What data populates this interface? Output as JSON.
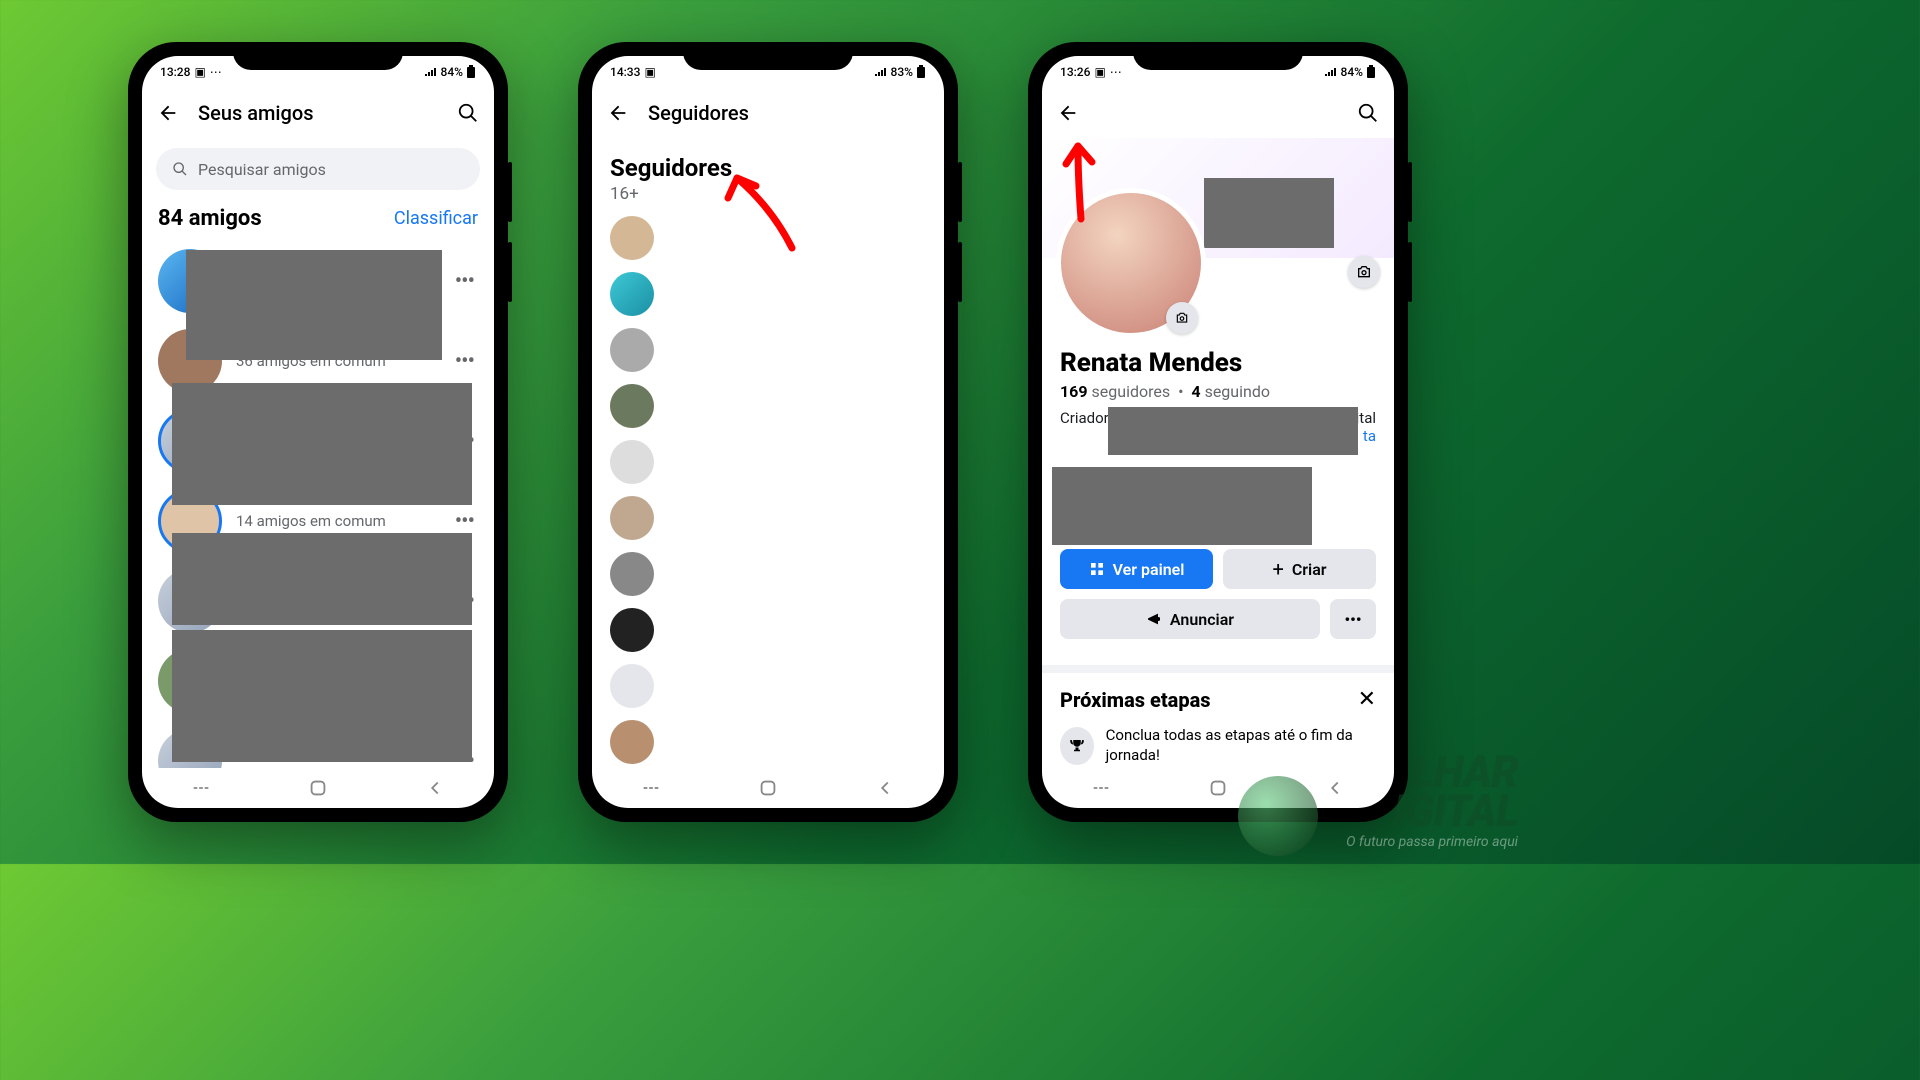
{
  "phone1": {
    "status": {
      "time": "13:28",
      "battery": "84%"
    },
    "header": {
      "title": "Seus amigos"
    },
    "search_placeholder": "Pesquisar amigos",
    "friends_count": "84 amigos",
    "sort_label": "Classificar",
    "rows": [
      {
        "sub": ""
      },
      {
        "sub": "36 amigos em comum"
      },
      {
        "sub": ""
      },
      {
        "sub": "14 amigos em comum"
      },
      {
        "sub": ""
      },
      {
        "sub": ""
      },
      {
        "sub": ""
      }
    ]
  },
  "phone2": {
    "status": {
      "time": "14:33",
      "battery": "83%"
    },
    "header": {
      "title": "Seguidores"
    },
    "followers_title": "Seguidores",
    "followers_count": "16+"
  },
  "phone3": {
    "status": {
      "time": "13:26",
      "battery": "84%"
    },
    "profile": {
      "name": "Renata Mendes",
      "followers_n": "169",
      "followers_l": "seguidores",
      "following_n": "4",
      "following_l": "seguindo",
      "bio_prefix": "Criador",
      "bio_suffix_visible": "g Digital",
      "link_hint": "ta"
    },
    "buttons": {
      "painel": "Ver painel",
      "criar": "Criar",
      "anunciar": "Anunciar"
    },
    "next": {
      "title": "Próximas etapas",
      "step1": "Conclua todas as etapas até o fim da jornada!"
    }
  },
  "watermark": {
    "line1": "LHAR",
    "line2": "IGITAL",
    "tag": "O futuro passa primeiro aqui"
  }
}
